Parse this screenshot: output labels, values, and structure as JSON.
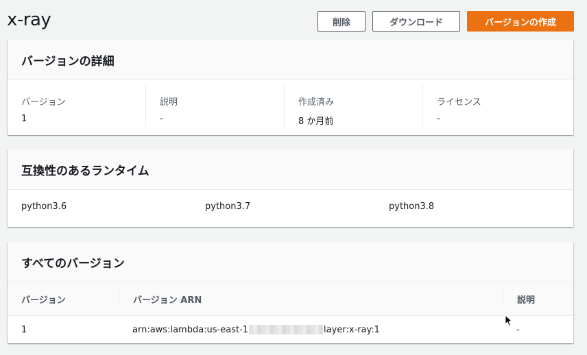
{
  "header": {
    "title": "x-ray",
    "delete_label": "削除",
    "download_label": "ダウンロード",
    "create_version_label": "バージョンの作成",
    "primary_color": "#ec7211"
  },
  "details": {
    "title": "バージョンの詳細",
    "fields": [
      {
        "label": "バージョン",
        "value": "1"
      },
      {
        "label": "説明",
        "value": "-"
      },
      {
        "label": "作成済み",
        "value": "8 か月前"
      },
      {
        "label": "ライセンス",
        "value": "-"
      }
    ]
  },
  "runtimes": {
    "title": "互換性のあるランタイム",
    "items": [
      "python3.6",
      "python3.7",
      "python3.8"
    ]
  },
  "versions": {
    "title": "すべてのバージョン",
    "columns": [
      "バージョン",
      "バージョン ARN",
      "説明"
    ],
    "rows": [
      {
        "version": "1",
        "arn_prefix": "arn:aws:lambda:us-east-1",
        "arn_suffix": "layer:x-ray:1",
        "description": "-"
      }
    ]
  }
}
